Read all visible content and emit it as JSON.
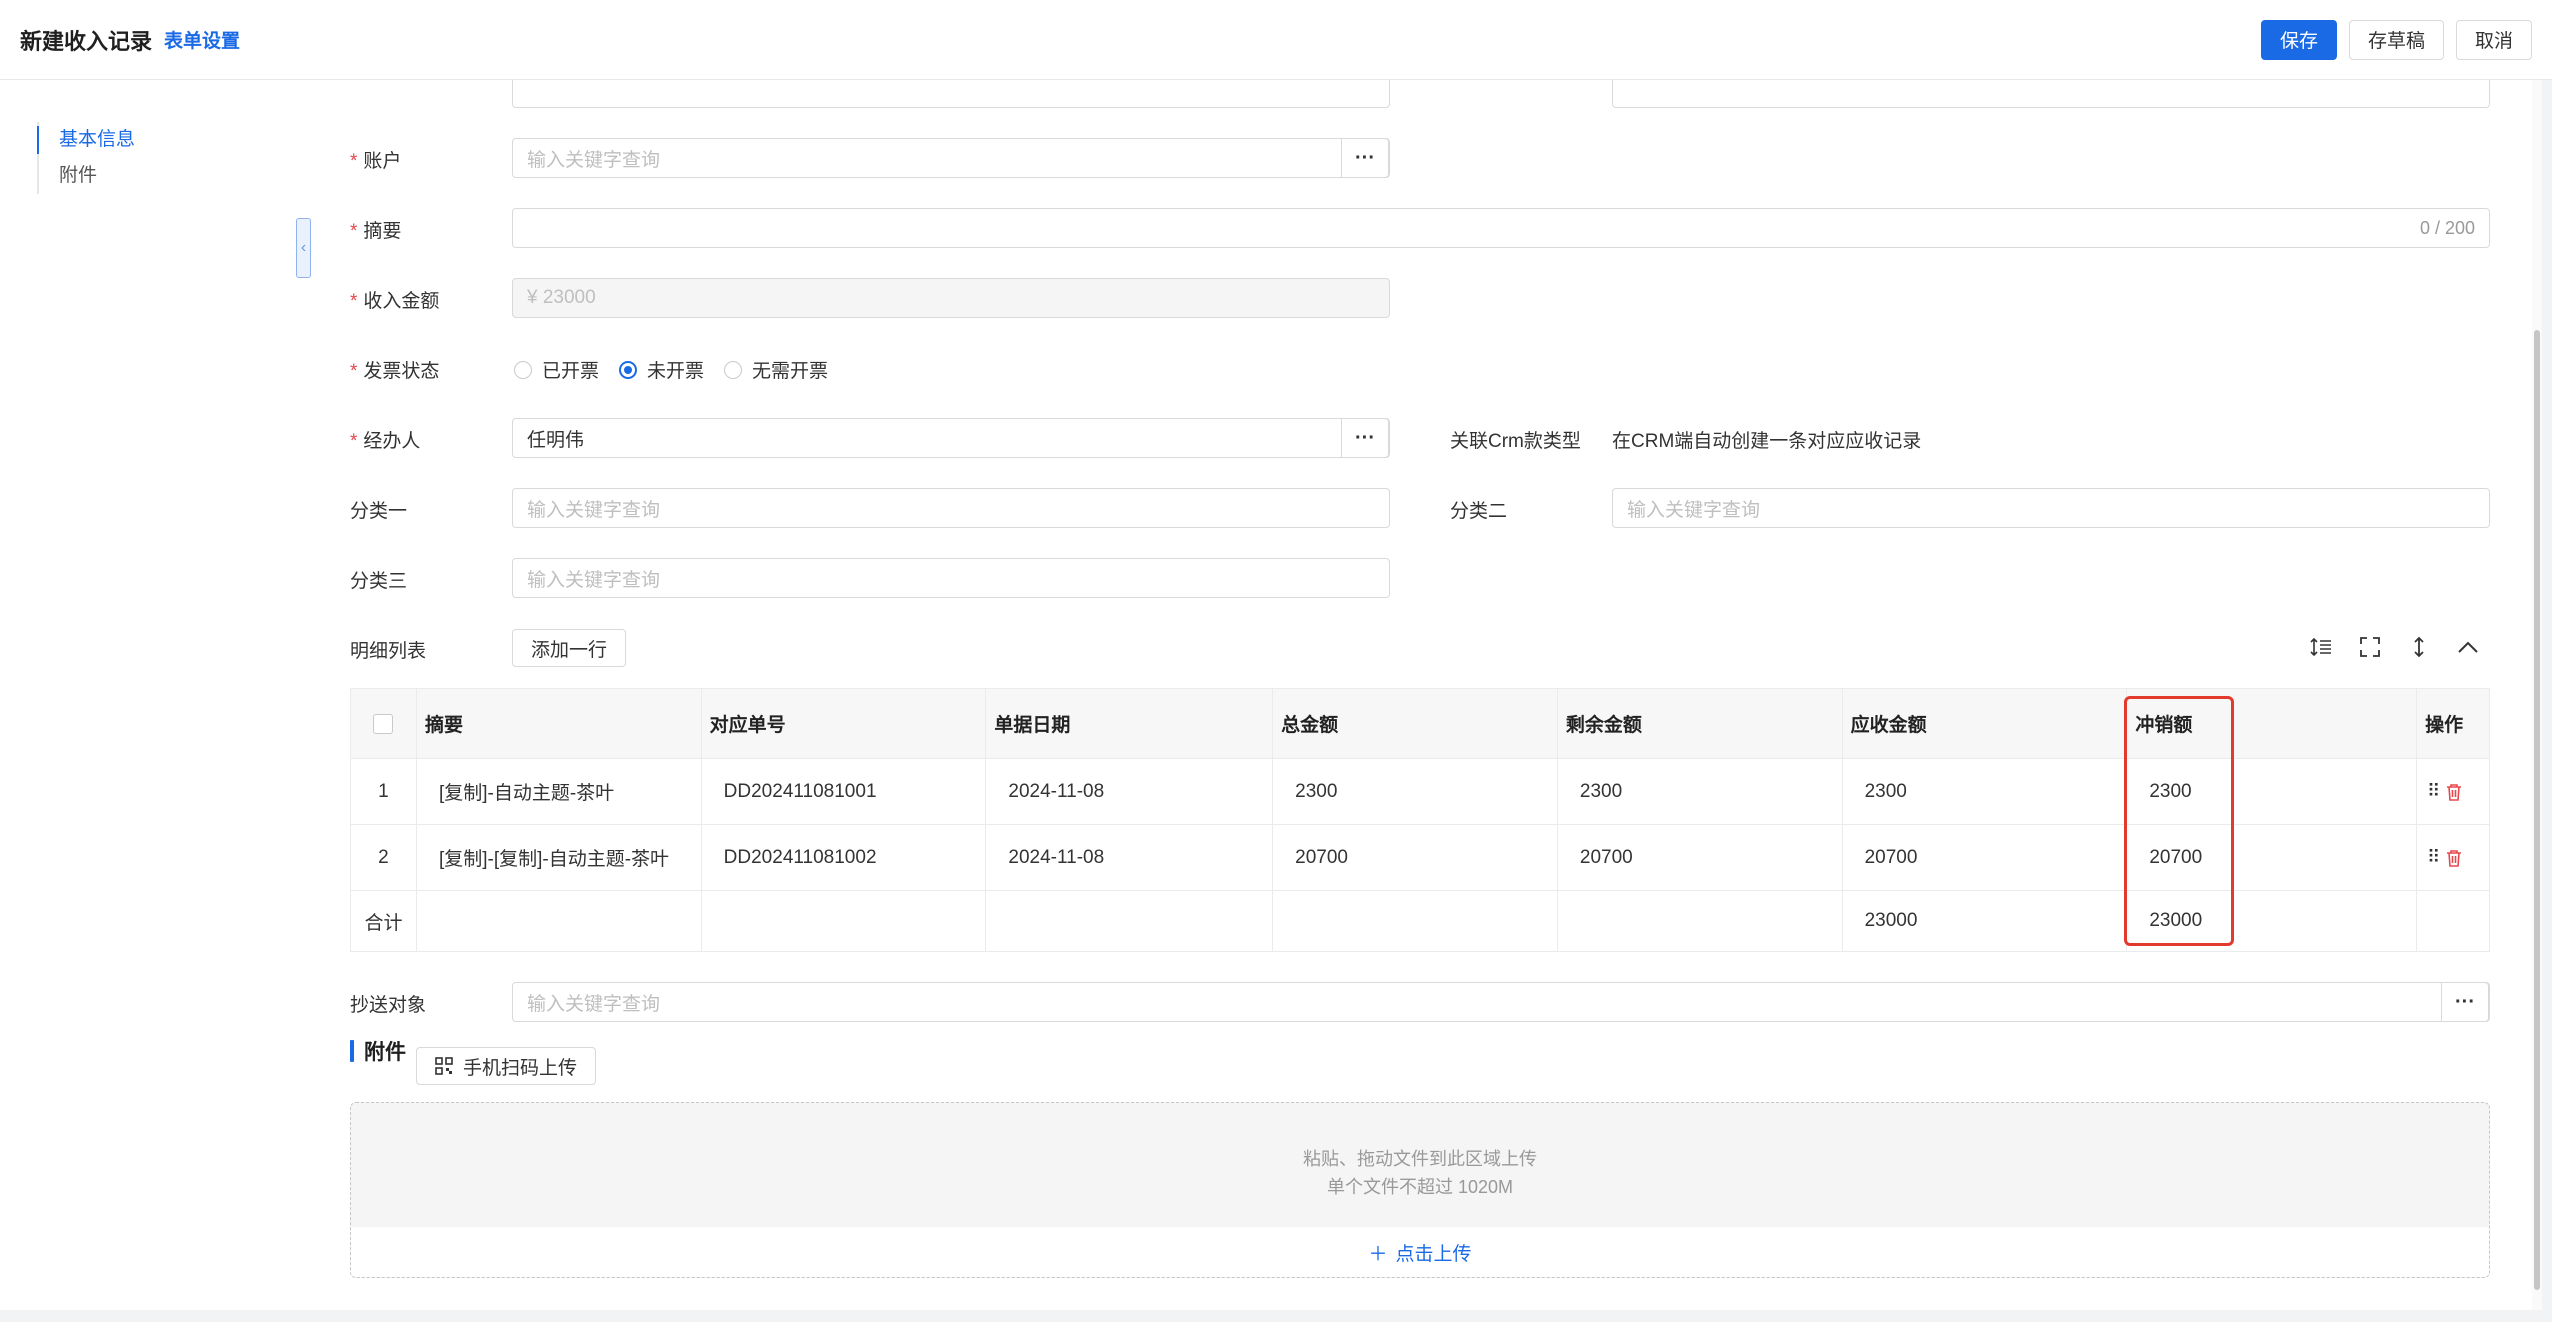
{
  "header": {
    "title": "新建收入记录",
    "form_settings": "表单设置",
    "save": "保存",
    "draft": "存草稿",
    "cancel": "取消"
  },
  "nav": {
    "items": [
      {
        "label": "基本信息",
        "active": true
      },
      {
        "label": "附件",
        "active": false
      }
    ]
  },
  "form": {
    "account": {
      "label": "账户",
      "placeholder": "输入关键字查询"
    },
    "summary": {
      "label": "摘要",
      "counter": "0 / 200"
    },
    "amount": {
      "label": "收入金额",
      "value": "¥ 23000"
    },
    "invoice_status": {
      "label": "发票状态",
      "options": [
        "已开票",
        "未开票",
        "无需开票"
      ],
      "selected": "未开票"
    },
    "handler": {
      "label": "经办人",
      "value": "任明伟"
    },
    "crm_type": {
      "label": "关联Crm款类型",
      "value": "在CRM端自动创建一条对应应收记录"
    },
    "category1": {
      "label": "分类一",
      "placeholder": "输入关键字查询"
    },
    "category2": {
      "label": "分类二",
      "placeholder": "输入关键字查询"
    },
    "category3": {
      "label": "分类三",
      "placeholder": "输入关键字查询"
    },
    "detail": {
      "label": "明细列表",
      "add_row": "添加一行"
    },
    "cc": {
      "label": "抄送对象",
      "placeholder": "输入关键字查询"
    }
  },
  "table": {
    "headers": [
      "摘要",
      "对应单号",
      "单据日期",
      "总金额",
      "剩余金额",
      "应收金额",
      "冲销额",
      "操作"
    ],
    "rows": [
      {
        "index": "1",
        "summary": "[复制]-自动主题-茶叶",
        "order": "DD202411081001",
        "date": "2024-11-08",
        "total": "2300",
        "remaining": "2300",
        "receivable": "2300",
        "writeoff": "2300"
      },
      {
        "index": "2",
        "summary": "[复制]-[复制]-自动主题-茶叶",
        "order": "DD202411081002",
        "date": "2024-11-08",
        "total": "20700",
        "remaining": "20700",
        "receivable": "20700",
        "writeoff": "20700"
      }
    ],
    "total_row": {
      "label": "合计",
      "receivable": "23000",
      "writeoff": "23000"
    }
  },
  "attachments": {
    "title": "附件",
    "scan_upload": "手机扫码上传",
    "drop_hint": "粘贴、拖动文件到此区域上传",
    "size_hint": "单个文件不超过 1020M",
    "click_upload": "点击上传"
  },
  "colors": {
    "primary": "#1a6ae6",
    "required": "#e5484d",
    "highlight": "#e23b2e",
    "danger": "#e5484d"
  }
}
